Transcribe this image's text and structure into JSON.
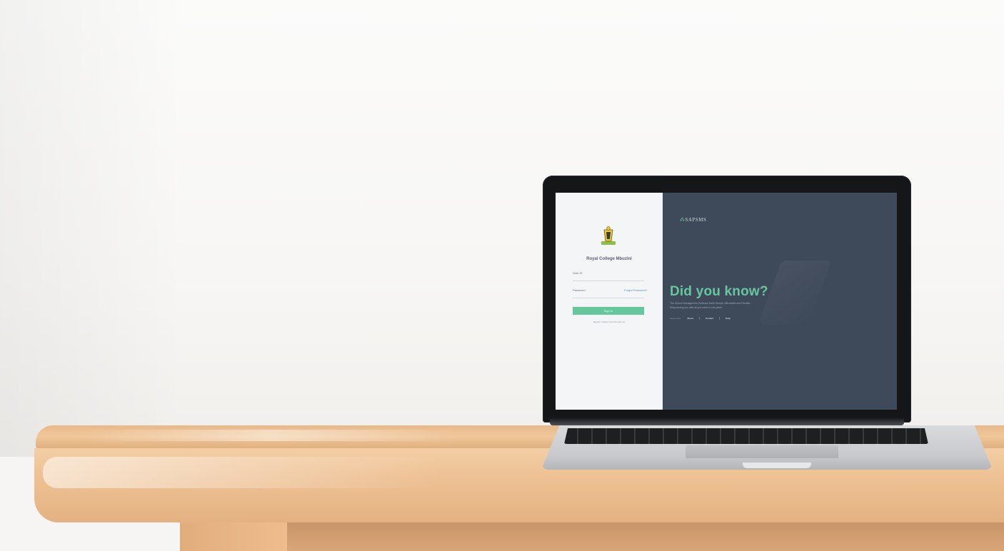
{
  "login": {
    "school_name": "Royal College Mbuzini",
    "user_id_label": "User ID",
    "password_label": "Password",
    "forgot_label": "Forgot Password?",
    "sign_in_label": "Sign In",
    "support_text": "Support | Rates Links through.xxx"
  },
  "info": {
    "brand_mark": "⁂",
    "brand_name": "SAPSMS",
    "headline": "Did you know?",
    "description": "The School Management Software that's Simple, Affordable and Flexible. Empowering you with all you need in one place.",
    "links_label": "Learn more:",
    "links": [
      "About",
      "Contact",
      "Help"
    ]
  },
  "colors": {
    "accent": "#66c79e",
    "info_bg": "#3e4959",
    "login_bg": "#f4f5f6"
  }
}
